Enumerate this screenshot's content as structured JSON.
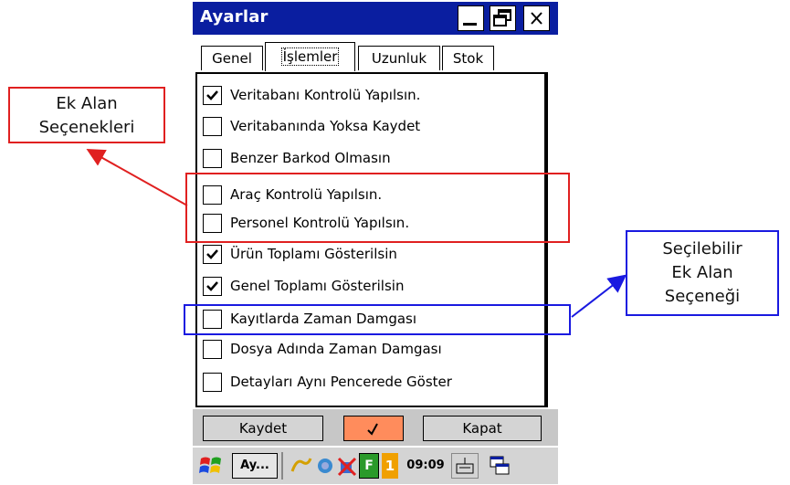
{
  "window": {
    "title": "Ayarlar"
  },
  "title_buttons": [
    "minimize-icon",
    "restore-icon",
    "close-icon"
  ],
  "tabs": [
    {
      "label": "Genel",
      "active": false
    },
    {
      "label": "İşlemler",
      "active": true
    },
    {
      "label": "Uzunluk",
      "active": false
    },
    {
      "label": "Stok",
      "active": false
    }
  ],
  "options": [
    {
      "label": "Veritabanı Kontrolü Yapılsın.",
      "checked": true
    },
    {
      "label": "Veritabanında Yoksa Kaydet",
      "checked": false
    },
    {
      "label": "Benzer Barkod Olmasın",
      "checked": false
    },
    {
      "label": "Araç Kontrolü Yapılsın.",
      "checked": false
    },
    {
      "label": "Personel Kontrolü Yapılsın.",
      "checked": false
    },
    {
      "label": "Ürün Toplamı Gösterilsin",
      "checked": true
    },
    {
      "label": "Genel Toplamı Gösterilsin",
      "checked": true
    },
    {
      "label": "Kayıtlarda Zaman Damgası",
      "checked": false
    },
    {
      "label": "Dosya Adında Zaman Damgası",
      "checked": false
    },
    {
      "label": "Detayları Aynı Pencerede Göster",
      "checked": false
    }
  ],
  "buttons": {
    "save": "Kaydet",
    "ok_icon": "check-icon",
    "close": "Kapat"
  },
  "taskbar": {
    "start_icon": "windows-flag-icon",
    "app_button": "Ay...",
    "time": "09:09",
    "badge_text": "F",
    "badge2_text": "1"
  },
  "annotations": {
    "ek_alan": {
      "line1": "Ek Alan",
      "line2": "Seçenekleri",
      "color": "#e02020"
    },
    "secilebilir": {
      "line1": "Seçilebilir",
      "line2": "Ek Alan",
      "line3": "Seçeneği",
      "color": "#1a1ae0"
    }
  },
  "colors": {
    "titlebar": "#0a1ea0",
    "ok_button": "#ff8c5c"
  }
}
